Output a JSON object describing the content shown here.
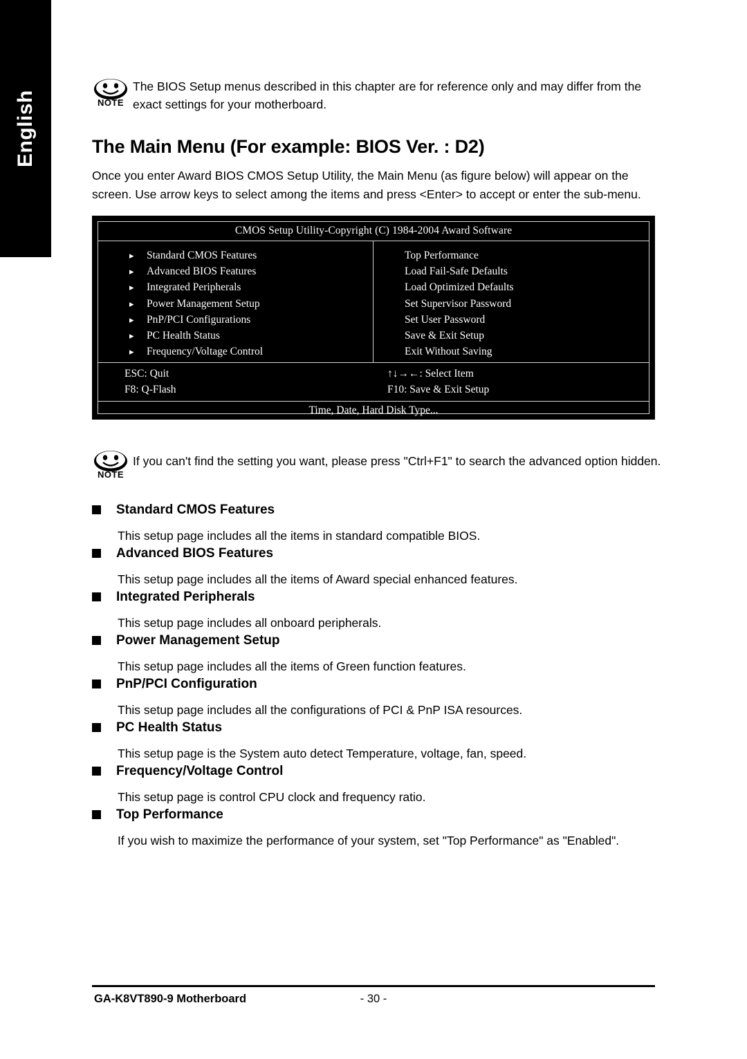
{
  "side_tab": {
    "label": "English"
  },
  "note_top": {
    "icon_label": "NOTE",
    "text": "The BIOS Setup menus described in this chapter are for reference only and may differ from the exact settings for your motherboard."
  },
  "heading": "The Main Menu (For example: BIOS Ver. : D2)",
  "intro": "Once you enter Award BIOS CMOS Setup Utility, the Main Menu (as figure below) will appear on the screen. Use arrow keys to select among the items and press <Enter> to accept or enter the sub-menu.",
  "bios": {
    "title": "CMOS Setup Utility-Copyright (C) 1984-2004 Award Software",
    "left_items": [
      "Standard CMOS Features",
      "Advanced BIOS Features",
      "Integrated Peripherals",
      "Power Management Setup",
      "PnP/PCI Configurations",
      "PC Health Status",
      "Frequency/Voltage Control"
    ],
    "right_items": [
      "Top Performance",
      "Load Fail-Safe Defaults",
      "Load Optimized Defaults",
      "Set Supervisor Password",
      "Set User Password",
      "Save & Exit Setup",
      "Exit Without Saving"
    ],
    "keys_left": [
      "ESC: Quit",
      "F8: Q-Flash"
    ],
    "keys_right": [
      "↑↓→←: Select Item",
      "F10: Save & Exit Setup"
    ],
    "footer": "Time, Date, Hard Disk Type..."
  },
  "note_bottom": {
    "icon_label": "NOTE",
    "text": "If you can't find the setting you want, please press \"Ctrl+F1\" to search the advanced option hidden."
  },
  "sections": [
    {
      "title": "Standard CMOS Features",
      "desc": "This setup page includes all the items in standard compatible BIOS."
    },
    {
      "title": "Advanced BIOS Features",
      "desc": "This setup page includes all the items of Award special enhanced features."
    },
    {
      "title": "Integrated Peripherals",
      "desc": "This setup page includes all onboard peripherals."
    },
    {
      "title": "Power Management Setup",
      "desc": "This setup page includes all the items of Green function features."
    },
    {
      "title": "PnP/PCI Configuration",
      "desc": "This setup page includes all the configurations of PCI & PnP ISA resources."
    },
    {
      "title": "PC Health Status",
      "desc": "This setup page is the System auto detect Temperature, voltage, fan, speed."
    },
    {
      "title": "Frequency/Voltage Control",
      "desc": "This setup page is control CPU clock and frequency ratio."
    },
    {
      "title": "Top Performance",
      "desc": "If you wish to maximize the performance of your system, set \"Top Performance\" as \"Enabled\"."
    }
  ],
  "footer": {
    "left": "GA-K8VT890-9 Motherboard",
    "center": "- 30 -"
  }
}
